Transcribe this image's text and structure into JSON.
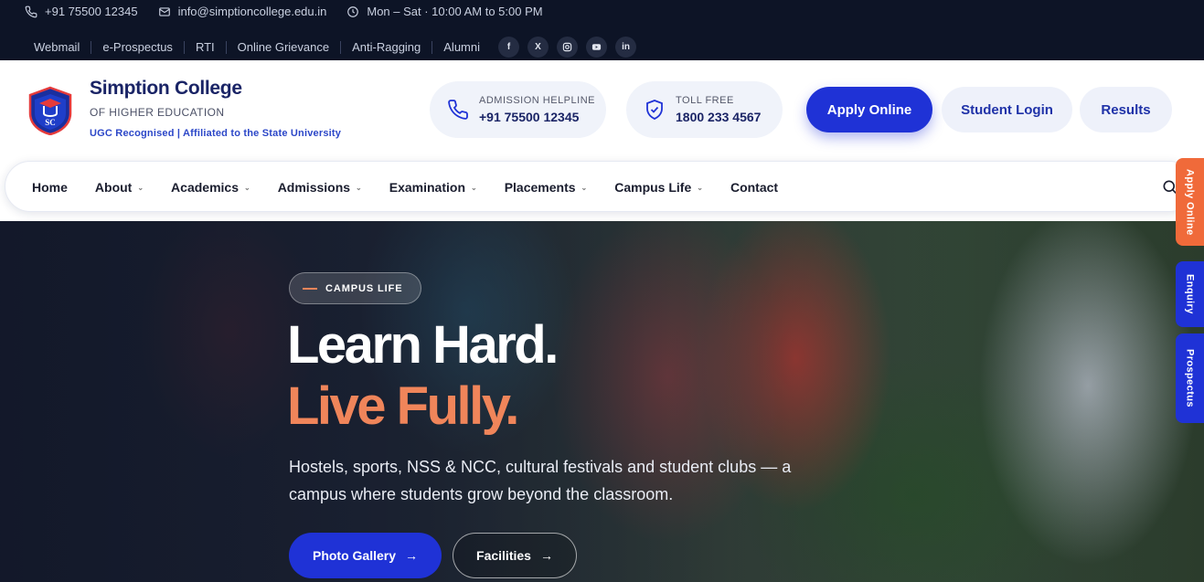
{
  "topbar": {
    "phone": "+91 75500 12345",
    "email": "info@simptioncollege.edu.in",
    "hours": "Mon – Sat · 10:00 AM to 5:00 PM",
    "links": [
      "Webmail",
      "e-Prospectus",
      "RTI",
      "Online Grievance",
      "Anti-Ragging",
      "Alumni"
    ],
    "socials": [
      "f",
      "X",
      "in"
    ]
  },
  "header": {
    "logo_letters": "SC",
    "name": "Simption College",
    "subtitle": "OF HIGHER EDUCATION",
    "tagline": "UGC Recognised | Affiliated to the State University",
    "helpline_label": "ADMISSION HELPLINE",
    "helpline_number": "+91 75500 12345",
    "tollfree_label": "TOLL FREE",
    "tollfree_number": "1800 233 4567",
    "apply_label": "Apply Online",
    "login_label": "Student Login",
    "results_label": "Results"
  },
  "nav": {
    "items": [
      "Home",
      "About",
      "Academics",
      "Admissions",
      "Examination",
      "Placements",
      "Campus Life",
      "Contact"
    ],
    "chevron": "⌄"
  },
  "hero": {
    "badge": "CAMPUS LIFE",
    "headline1": "Learn Hard.",
    "headline2": "Live Fully.",
    "description": "Hostels, sports, NSS & NCC, cultural festivals and student clubs — a campus where students grow beyond the classroom.",
    "gallery_label": "Photo Gallery",
    "facilities_label": "Facilities",
    "arrow": "→"
  },
  "side_tabs": {
    "apply": "Apply Online",
    "enquiry": "Enquiry",
    "prospectus": "Prospectus"
  },
  "colors": {
    "topbar_bg": "#0d1426",
    "brand_navy": "#1a2466",
    "primary_blue": "#1f32d6",
    "accent_orange": "#f0855a",
    "side_apply_orange": "#f06a3a"
  },
  "icons": [
    "phone-icon",
    "mail-icon",
    "clock-icon",
    "facebook-icon",
    "x-icon",
    "instagram-icon",
    "youtube-icon",
    "linkedin-icon",
    "shield-icon",
    "search-icon",
    "arrow-right-icon"
  ]
}
